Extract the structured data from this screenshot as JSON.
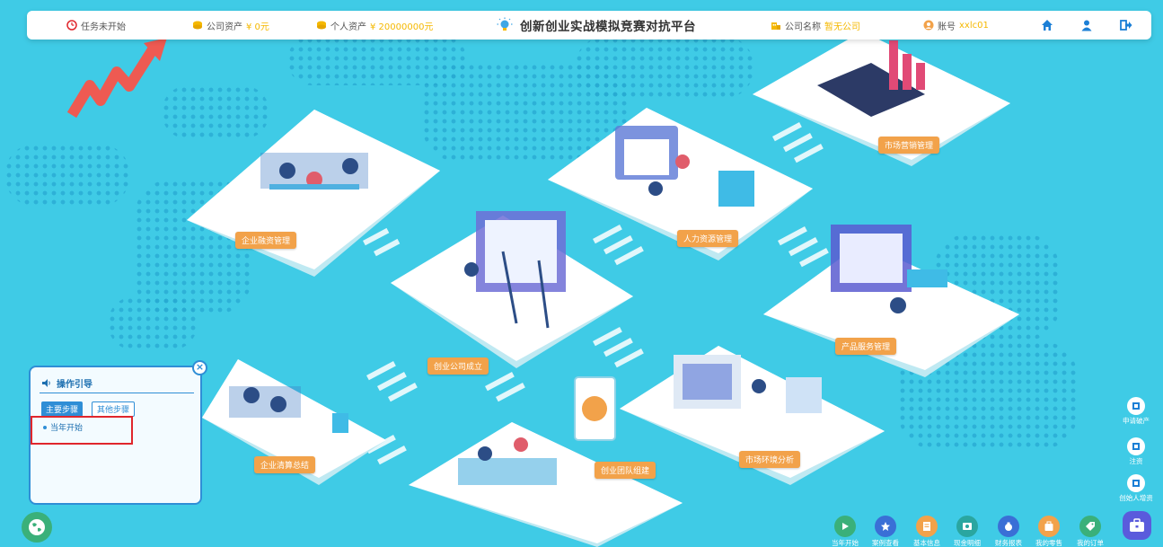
{
  "topbar": {
    "task_status": "任务未开始",
    "company_assets_label": "公司资产",
    "company_assets_value": "¥ 0元",
    "personal_assets_label": "个人资产",
    "personal_assets_value": "¥ 20000000元",
    "title": "创新创业实战模拟竞赛对抗平台",
    "company_name_label": "公司名称",
    "company_name_value": "暂无公司",
    "account_label": "账号",
    "account_value": "xxlc01"
  },
  "modules": {
    "enterprise_finance": "企业融资管理",
    "hr": "人力资源管理",
    "marketing": "市场营销管理",
    "company_founding": "创业公司成立",
    "product_service": "产品服务管理",
    "liquidation": "企业清算总结",
    "team_building": "创业团队组建",
    "market_analysis": "市场环境分析"
  },
  "guide": {
    "title": "操作引导",
    "tab_main": "主要步骤",
    "tab_other": "其他步骤",
    "steps": [
      "当年开始"
    ]
  },
  "side_actions": [
    "申请破产",
    "注资",
    "创始人增资"
  ],
  "bottom_actions": [
    "当年开始",
    "案例查看",
    "基本信息",
    "现金明细",
    "财务报表",
    "我的零售",
    "我的订单"
  ],
  "colors": {
    "background": "#3fcbe6",
    "label_orange": "#f2a24a",
    "accent_blue": "#2f8ed6",
    "highlight_red": "#e0262c",
    "value_gold": "#f5b800"
  }
}
